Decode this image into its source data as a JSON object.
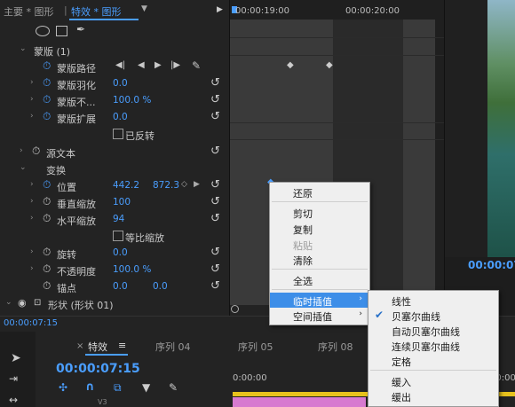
{
  "tabs": {
    "main": "主要 * 图形",
    "active": "特效 * 图形"
  },
  "timecodes": {
    "t1": "00:00:19:00",
    "t2": "00:00:20:00",
    "current": "00:00:07:15",
    "preview": "00:00:07",
    "seq": "00:00:07:15",
    "ruler": "0:00:00",
    "ruler2": "00:00"
  },
  "props": {
    "mask_group": "蒙版 (1)",
    "mask_path": "蒙版路径",
    "mask_feather": "蒙版羽化",
    "mask_feather_val": "0.0",
    "mask_opacity": "蒙版不...",
    "mask_opacity_val": "100.0 %",
    "mask_expand": "蒙版扩展",
    "mask_expand_val": "0.0",
    "inverted": "已反转",
    "source_text": "源文本",
    "transform": "变换",
    "position": "位置",
    "pos_x": "442.2",
    "pos_y": "872.3",
    "vscale": "垂直缩放",
    "vscale_val": "100",
    "hscale": "水平缩放",
    "hscale_val": "94",
    "uniform": "等比缩放",
    "rotation": "旋转",
    "rotation_val": "0.0",
    "opacity": "不透明度",
    "opacity_val": "100.0 %",
    "anchor": "锚点",
    "anchor_x": "0.0",
    "anchor_y": "0.0",
    "shape": "形状 (形状 01)"
  },
  "lower": {
    "tab_effects": "特效",
    "tab_seq04": "序列 04",
    "tab_seq05": "序列 05",
    "tab_seq08": "序列 08",
    "track": "V3"
  },
  "context_menu": {
    "undo": "还原",
    "cut": "剪切",
    "copy": "复制",
    "paste": "粘贴",
    "clear": "清除",
    "select_all": "全选",
    "temporal": "临时插值",
    "spatial": "空间插值"
  },
  "submenu": {
    "linear": "线性",
    "bezier": "贝塞尔曲线",
    "auto_bezier": "自动贝塞尔曲线",
    "cont_bezier": "连续贝塞尔曲线",
    "hold": "定格",
    "ease_in": "缓入",
    "ease_out": "缓出"
  }
}
